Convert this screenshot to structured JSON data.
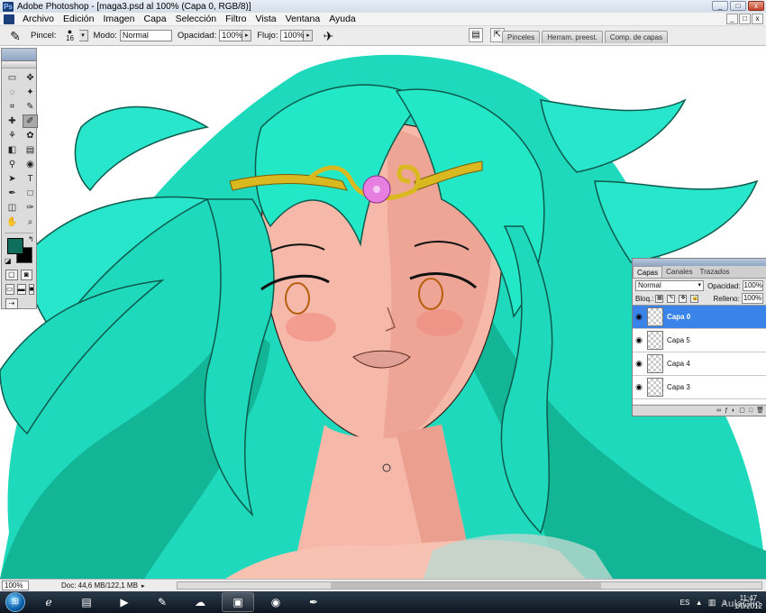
{
  "window": {
    "title": "Adobe Photoshop - [maga3.psd al 100% (Capa 0, RGB/8)]",
    "controls": [
      "_",
      "□",
      "x"
    ],
    "doc_controls": [
      "_",
      "□",
      "x"
    ]
  },
  "menu": {
    "items": [
      "Archivo",
      "Edición",
      "Imagen",
      "Capa",
      "Selección",
      "Filtro",
      "Vista",
      "Ventana",
      "Ayuda"
    ]
  },
  "options": {
    "brush_label": "Pincel:",
    "brush_size": "16",
    "mode_label": "Modo:",
    "mode_value": "Normal",
    "opacity_label": "Opacidad:",
    "opacity_value": "100%",
    "flow_label": "Flujo:",
    "flow_value": "100%"
  },
  "panel_well": {
    "tabs": [
      "Pinceles",
      "Herram. preest.",
      "Comp. de capas"
    ]
  },
  "toolbox": {
    "tools": [
      "▭",
      "✥",
      "◌",
      "✦",
      "⌗",
      "✎",
      "✚",
      "✐",
      "⚘",
      "✿",
      "◧",
      "▤",
      "⚲",
      "◉",
      "⬤",
      "◐",
      "➤",
      "T",
      "✒",
      "□",
      "✋",
      "⚲",
      "◫",
      "✑",
      "☝",
      "⌕"
    ],
    "fg_color": "#0f6e5c",
    "bg_color": "#000000"
  },
  "layers_panel": {
    "tabs": [
      "Capas",
      "Canales",
      "Trazados"
    ],
    "blend_mode": "Normal",
    "opacity_label": "Opacidad:",
    "opacity_value": "100%",
    "lock_label": "Bloq.:",
    "fill_label": "Relleno:",
    "fill_value": "100%",
    "layers": [
      {
        "name": "Capa 0",
        "selected": true
      },
      {
        "name": "Capa 5",
        "selected": false
      },
      {
        "name": "Capa 4",
        "selected": false
      },
      {
        "name": "Capa 3",
        "selected": false
      }
    ],
    "footer_icons": [
      "∞",
      "ƒ",
      "◐",
      "▢",
      "□",
      "🗑"
    ]
  },
  "status": {
    "zoom": "100%",
    "doc": "Doc: 44,6 MB/122,1 MB"
  },
  "taskbar": {
    "lang": "ES",
    "time": "11:47",
    "date": "1/0/2012",
    "watermark": "AulaClic"
  },
  "colors": {
    "hair": "#22e8c8",
    "hair_dark": "#10b89a",
    "skin": "#f6b8a8",
    "skin_shadow": "#eb9d8c",
    "tiara": "#d9b820",
    "flower": "#e67fe0",
    "selection_blue": "#3a83e8"
  }
}
